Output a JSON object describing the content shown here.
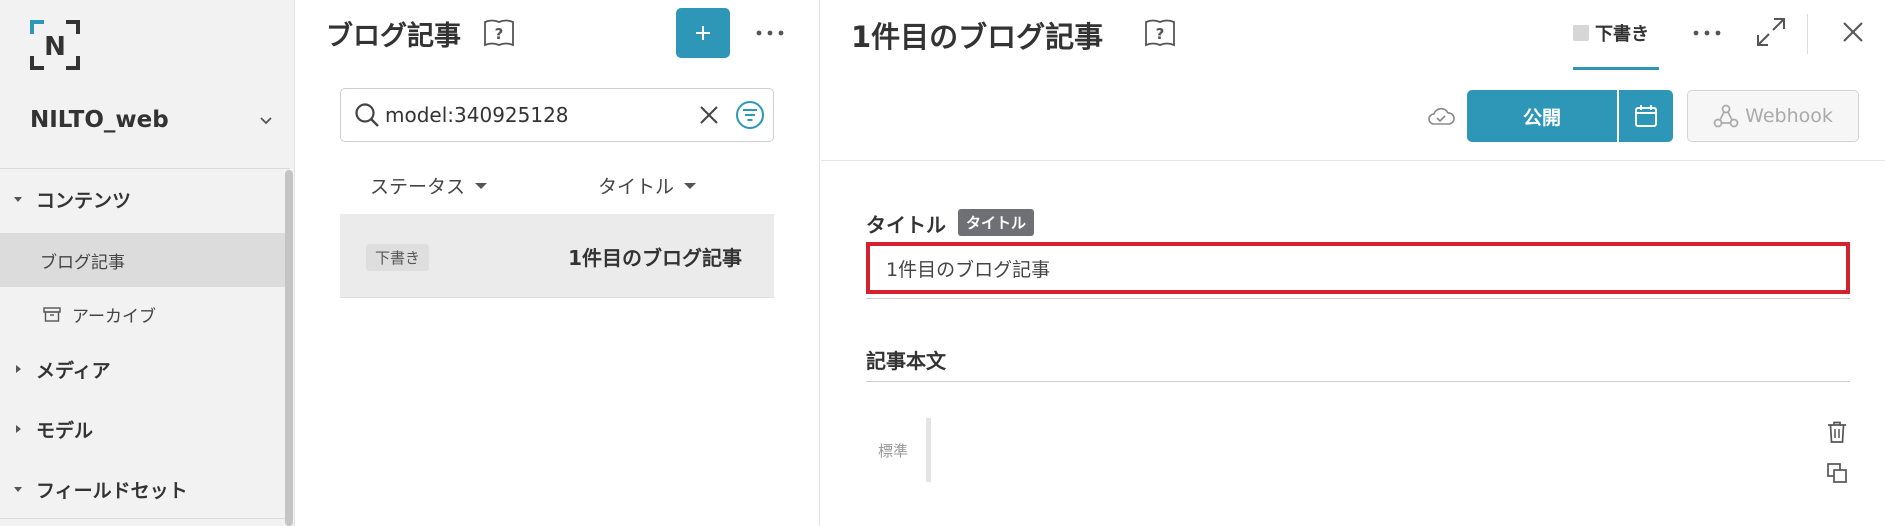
{
  "colors": {
    "accent": "#2e97b8",
    "highlight": "#d3222f",
    "tag": "#6e7076"
  },
  "sidebar": {
    "logo_letter": "N",
    "project_name": "NILTO_web",
    "nav": [
      {
        "label": "コンテンツ",
        "expanded": true
      },
      {
        "label": "メディア",
        "expanded": false
      },
      {
        "label": "モデル",
        "expanded": false
      },
      {
        "label": "フィールドセット",
        "expanded": true
      }
    ],
    "content_items": [
      {
        "label": "ブログ記事",
        "active": true
      },
      {
        "label": "アーカイブ",
        "icon": "archive-icon",
        "active": false
      }
    ]
  },
  "list": {
    "title": "ブログ記事",
    "search": {
      "value": "model:340925128"
    },
    "columns": {
      "status": "ステータス",
      "title": "タイトル"
    },
    "rows": [
      {
        "status": "下書き",
        "title": "1件目のブログ記事"
      }
    ]
  },
  "detail": {
    "title": "1件目のブログ記事",
    "status_tab": "下書き",
    "publish_label": "公開",
    "webhook_label": "Webhook",
    "fields": {
      "title_label": "タイトル",
      "title_tag": "タイトル",
      "title_value": "1件目のブログ記事",
      "body_label": "記事本文",
      "block_style": "標準"
    }
  }
}
